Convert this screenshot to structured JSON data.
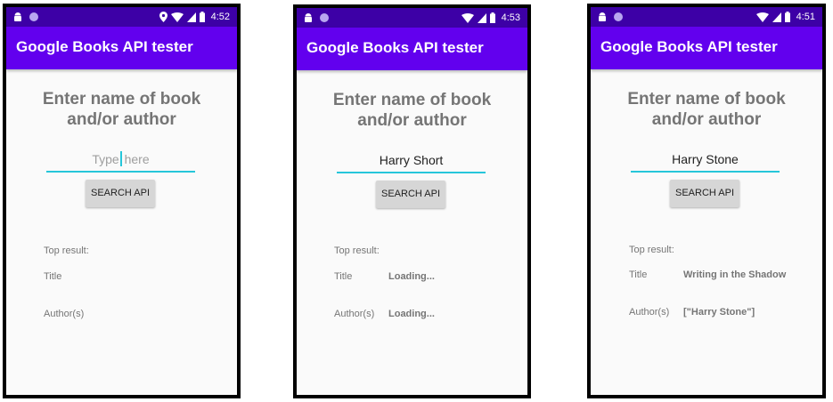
{
  "screens": [
    {
      "status": {
        "time": "4:52",
        "location_icon": "location-icon"
      },
      "app_title": "Google Books API tester",
      "prompt_line1": "Enter name of book",
      "prompt_line2": "and/or author",
      "search": {
        "value": "",
        "placeholder_before_caret": "Type",
        "placeholder_after_caret": " here"
      },
      "button_label": "SEARCH API",
      "top_result_label": "Top result:",
      "title_label": "Title",
      "title_value": "",
      "author_label": "Author(s)",
      "author_value": ""
    },
    {
      "status": {
        "time": "4:53"
      },
      "app_title": "Google Books API tester",
      "prompt_line1": "Enter name of book",
      "prompt_line2": "and/or author",
      "search": {
        "value": "Harry Short"
      },
      "button_label": "SEARCH API",
      "top_result_label": "Top result:",
      "title_label": "Title",
      "title_value": "Loading...",
      "author_label": "Author(s)",
      "author_value": "Loading..."
    },
    {
      "status": {
        "time": "4:51"
      },
      "app_title": "Google Books API tester",
      "prompt_line1": "Enter name of book",
      "prompt_line2": "and/or author",
      "search": {
        "value": "Harry Stone"
      },
      "button_label": "SEARCH API",
      "top_result_label": "Top result:",
      "title_label": "Title",
      "title_value": "Writing in the Shadow",
      "author_label": "Author(s)",
      "author_value": "[\"Harry Stone\"]"
    }
  ],
  "colors": {
    "status_bar": "#3d00a6",
    "app_bar": "#6200ee",
    "accent": "#26c6da",
    "background": "#fafafa",
    "button": "#d6d6d6"
  }
}
